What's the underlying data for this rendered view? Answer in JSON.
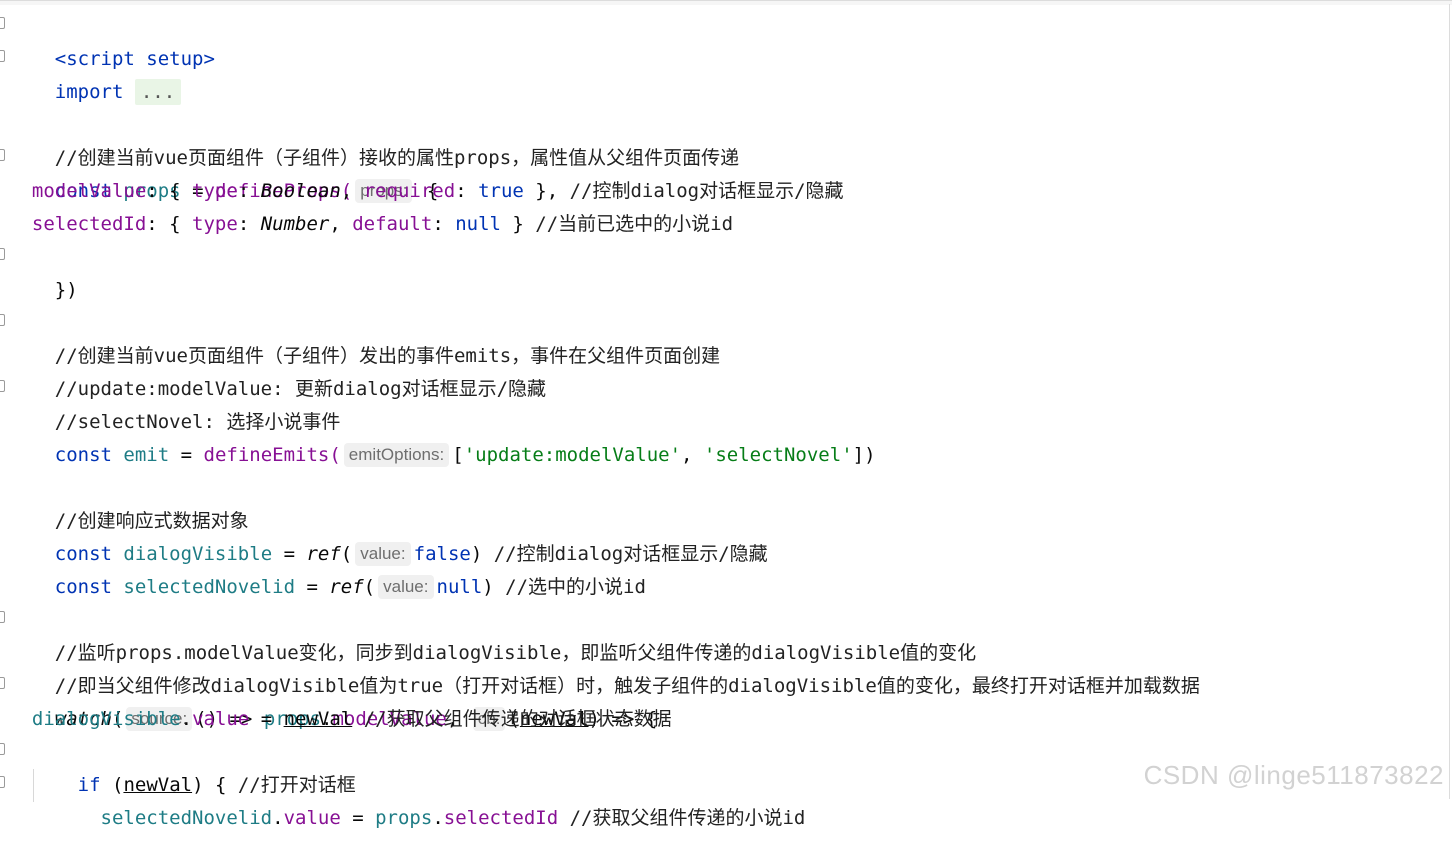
{
  "code": {
    "script_open_tag": "<script setup>",
    "import_kw": "import",
    "import_collapsed": "...",
    "comment_props": "//创建当前vue页面组件（子组件）接收的属性props，属性值从父组件页面传递",
    "props_const": "const",
    "props_name": "props",
    "props_fn": "defineProps(",
    "props_hint": "props:",
    "props_open_brace": " {",
    "modelValue_key": "modelValue",
    "modelValue_type_key": "type",
    "modelValue_type": "Boolean",
    "modelValue_required_key": "required",
    "modelValue_required_val": "true",
    "modelValue_comment": "//控制dialog对话框显示/隐藏",
    "selectedId_key": "selectedId",
    "selectedId_type_key": "type",
    "selectedId_type": "Number",
    "selectedId_default_key": "default",
    "selectedId_default_val": "null",
    "selectedId_comment": "//当前已选中的小说id",
    "props_close": "})",
    "comment_emits": "//创建当前vue页面组件（子组件）发出的事件emits，事件在父组件页面创建",
    "comment_update": "//update:modelValue: 更新dialog对话框显示/隐藏",
    "comment_select": "//selectNovel: 选择小说事件",
    "emit_const": "const",
    "emit_name": "emit",
    "emit_fn": "defineEmits(",
    "emit_hint": "emitOptions:",
    "emit_str1": "'update:modelValue'",
    "emit_str2": "'selectNovel'",
    "comment_reactive": "//创建响应式数据对象",
    "dv_const": "const",
    "dv_name": "dialogVisible",
    "dv_ref": "ref",
    "dv_hint": "value:",
    "dv_val": "false",
    "dv_comment": "//控制dialog对话框显示/隐藏",
    "sn_const": "const",
    "sn_name": "selectedNovelid",
    "sn_ref": "ref",
    "sn_hint": "value:",
    "sn_val": "null",
    "sn_comment": "//选中的小说id",
    "comment_watch1": "//监听props.modelValue变化，同步到dialogVisible，即监听父组件传递的dialogVisible值的变化",
    "comment_watch2": "//即当父组件修改dialogVisible值为true（打开对话框）时，触发子组件的dialogVisible值的变化，最终打开对话框并加载数据",
    "watch_fn": "watch",
    "watch_hint_source": "source:",
    "watch_props": "props",
    "watch_modelValue": "modelValue",
    "watch_hint_cb": "cb:",
    "watch_param": "newVal",
    "assign_dv": "dialogVisible",
    "assign_value": "value",
    "assign_newVal": "newVal",
    "assign_comment": "//获取父组件传递的对话框状态数据",
    "if_kw": "if",
    "if_param": "newVal",
    "if_comment": "//打开对话框",
    "sel_var": "selectedNovelid",
    "sel_value": "value",
    "sel_props": "props",
    "sel_selectedId": "selectedId",
    "sel_comment": "//获取父组件传递的小说id"
  },
  "watermark": "CSDN @linge511873822",
  "colors": {
    "keyword": "#0033b3",
    "function": "#00627a",
    "property": "#871094",
    "string": "#067d17",
    "identifier": "#1e7c85"
  }
}
